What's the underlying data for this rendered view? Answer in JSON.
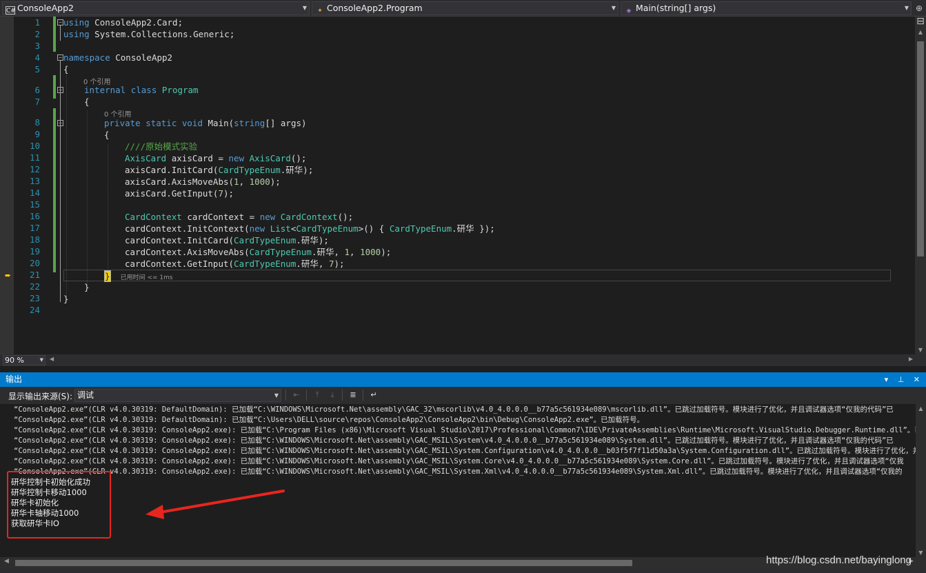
{
  "navbar": {
    "project_dropdown": "ConsoleApp2",
    "project_icon": "C#",
    "class_dropdown": "ConsoleApp2.Program",
    "member_dropdown": "Main(string[] args)"
  },
  "editor": {
    "line_numbers": [
      "1",
      "2",
      "3",
      "4",
      "5",
      "6",
      "7",
      "8",
      "9",
      "10",
      "11",
      "12",
      "13",
      "14",
      "15",
      "16",
      "17",
      "18",
      "19",
      "20",
      "21",
      "22",
      "23",
      "24"
    ],
    "code_lens_1": "0 个引用",
    "code_lens_2": "0 个引用",
    "perf_tip": "已用时间 <= 1ms",
    "code": {
      "l1_kw": "using",
      "l1_rest": " ConsoleApp2.Card;",
      "l2_kw": "using",
      "l2_rest": " System.Collections.Generic;",
      "l4_kw": "namespace",
      "l4_rest": " ConsoleApp2",
      "l5": "{",
      "l6_kw": "internal class",
      "l6_ty": "Program",
      "l7": "{",
      "l8_kw": "private static void",
      "l8_name": " Main(",
      "l8_kw2": "string",
      "l8_rest": "[] args)",
      "l9": "{",
      "l10": "////原始模式实验",
      "l11_ty": "AxisCard",
      "l11_a": " axisCard = ",
      "l11_kw": "new",
      "l11_ty2": " AxisCard",
      "l11_b": "();",
      "l12_a": "axisCard.InitCard(",
      "l12_ty": "CardTypeEnum",
      "l12_b": ".研华);",
      "l13_a": "axisCard.AxisMoveAbs(",
      "l13_n1": "1",
      "l13_sep": ", ",
      "l13_n2": "1000",
      "l13_b": ");",
      "l14_a": "axisCard.GetInput(",
      "l14_n": "7",
      "l14_b": ");",
      "l16_ty": "CardContext",
      "l16_a": " cardContext = ",
      "l16_kw": "new",
      "l16_ty2": " CardContext",
      "l16_b": "();",
      "l17_a": "cardContext.InitContext(",
      "l17_kw": "new",
      "l17_ty": " List",
      "l17_lt": "<",
      "l17_ty2": "CardTypeEnum",
      "l17_gt": ">() { ",
      "l17_ty3": "CardTypeEnum",
      "l17_b": ".研华 });",
      "l18_a": "cardContext.InitCard(",
      "l18_ty": "CardTypeEnum",
      "l18_b": ".研华);",
      "l19_a": "cardContext.AxisMoveAbs(",
      "l19_ty": "CardTypeEnum",
      "l19_b": ".研华, ",
      "l19_n1": "1",
      "l19_sep": ", ",
      "l19_n2": "1000",
      "l19_c": ");",
      "l20_a": "cardContext.GetInput(",
      "l20_ty": "CardTypeEnum",
      "l20_b": ".研华, ",
      "l20_n": "7",
      "l20_c": ");",
      "l21": "}",
      "l22": "}",
      "l23": "}"
    }
  },
  "zoom": {
    "value": "90 %"
  },
  "output": {
    "title": "输出",
    "title_buttons": "▾ ⊥ ✕",
    "source_label": "显示输出来源(S):",
    "source_value": "调试",
    "lines": [
      "“ConsoleApp2.exe”(CLR v4.0.30319: DefaultDomain): 已加载“C:\\WINDOWS\\Microsoft.Net\\assembly\\GAC_32\\mscorlib\\v4.0_4.0.0.0__b77a5c561934e089\\mscorlib.dll”。已跳过加载符号。模块进行了优化，并且调试器选项“仅我的代码”已",
      "“ConsoleApp2.exe”(CLR v4.0.30319: DefaultDomain): 已加载“C:\\Users\\DELL\\source\\repos\\ConsoleApp2\\ConsoleApp2\\bin\\Debug\\ConsoleApp2.exe”。已加载符号。",
      "“ConsoleApp2.exe”(CLR v4.0.30319: ConsoleApp2.exe): 已加载“C:\\Program Files (x86)\\Microsoft Visual Studio\\2017\\Professional\\Common7\\IDE\\PrivateAssemblies\\Runtime\\Microsoft.VisualStudio.Debugger.Runtime.dll”。已跳过",
      "“ConsoleApp2.exe”(CLR v4.0.30319: ConsoleApp2.exe): 已加载“C:\\WINDOWS\\Microsoft.Net\\assembly\\GAC_MSIL\\System\\v4.0_4.0.0.0__b77a5c561934e089\\System.dll”。已跳过加载符号。模块进行了优化，并且调试器选项“仅我的代码”已",
      "“ConsoleApp2.exe”(CLR v4.0.30319: ConsoleApp2.exe): 已加载“C:\\WINDOWS\\Microsoft.Net\\assembly\\GAC_MSIL\\System.Configuration\\v4.0_4.0.0.0__b03f5f7f11d50a3a\\System.Configuration.dll”。已跳过加载符号。模块进行了优化，并",
      "“ConsoleApp2.exe”(CLR v4.0.30319: ConsoleApp2.exe): 已加载“C:\\WINDOWS\\Microsoft.Net\\assembly\\GAC_MSIL\\System.Core\\v4.0_4.0.0.0__b77a5c561934e089\\System.Core.dll”。已跳过加载符号。模块进行了优化，并且调试器选项“仅我",
      "“ConsoleApp2.exe”(CLR v4.0.30319: ConsoleApp2.exe): 已加载“C:\\WINDOWS\\Microsoft.Net\\assembly\\GAC_MSIL\\System.Xml\\v4.0_4.0.0.0__b77a5c561934e089\\System.Xml.dll”。已跳过加载符号。模块进行了优化，并且调试器选项“仅我的",
      "研华控制卡初始化成功",
      "研华控制卡移动1000",
      "研华卡初始化",
      "研华卡轴移动1000",
      "获取研华卡IO"
    ]
  },
  "watermark": "https://blog.csdn.net/bayinglong",
  "colors": {
    "accent": "#007acc",
    "editor_bg": "#1e1e1e",
    "keyword": "#569cd6",
    "type": "#4ec9b0",
    "comment": "#57a64a",
    "annotation_red": "#e8261e"
  },
  "icons": {
    "project": "csharp-project-icon",
    "class": "class-icon",
    "member": "method-icon",
    "current_statement": "current-statement-arrow-icon"
  }
}
